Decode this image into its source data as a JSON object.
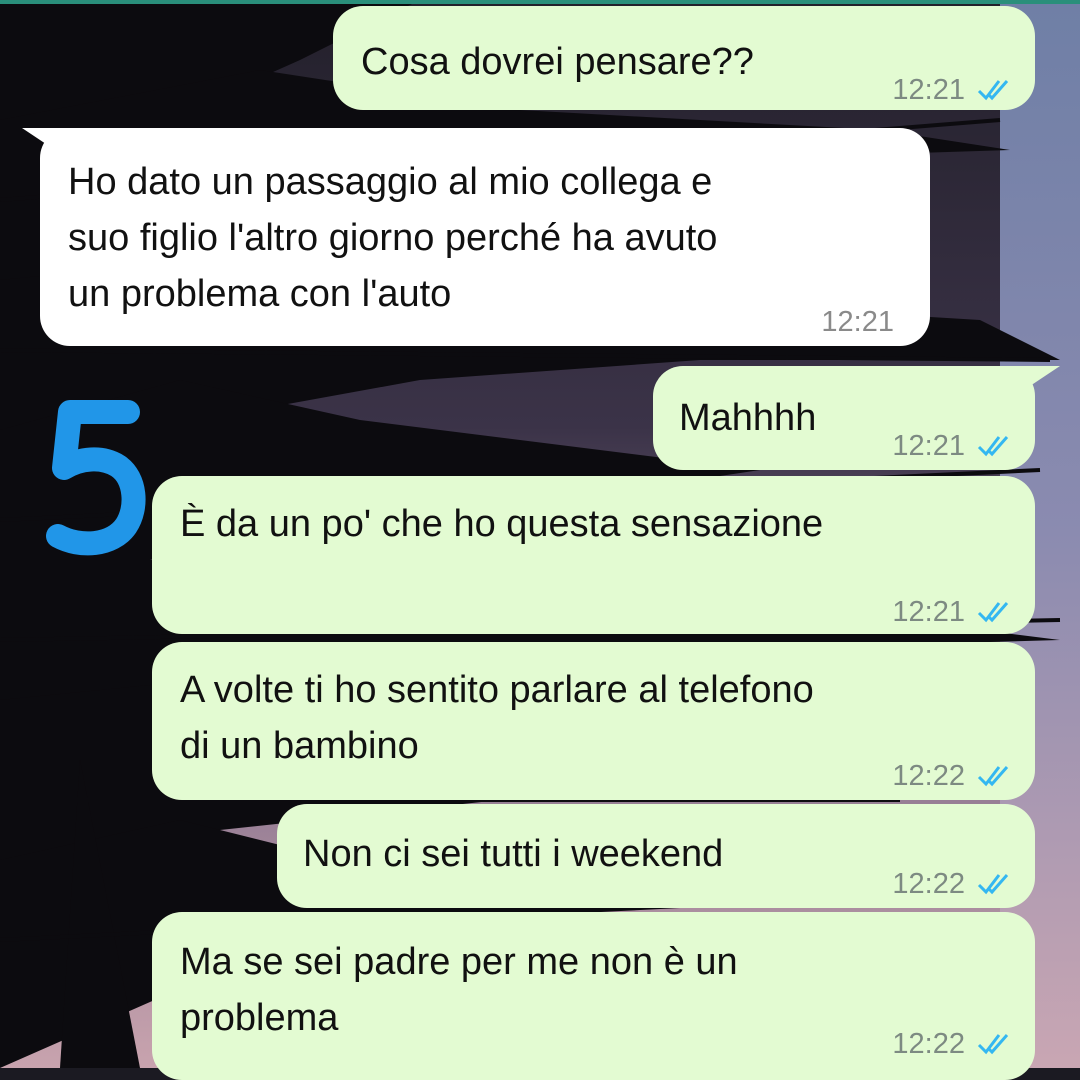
{
  "colors": {
    "outgoing_bubble": "#e3fbd2",
    "incoming_bubble": "#ffffff",
    "read_ticks": "#34b7f1",
    "annotation_number": "#2196e8"
  },
  "annotation": {
    "number": "5"
  },
  "messages": [
    {
      "direction": "outgoing",
      "text": "Cosa dovrei pensare??",
      "time": "12:21",
      "status": "read"
    },
    {
      "direction": "incoming",
      "text": "Ho dato un passaggio al mio collega e\nsuo figlio l'altro giorno perché ha avuto\nun problema con l'auto",
      "time": "12:21"
    },
    {
      "direction": "outgoing",
      "text": "Mahhhh",
      "time": "12:21",
      "status": "read"
    },
    {
      "direction": "outgoing",
      "text": "È da un po' che ho questa sensazione",
      "time": "12:21",
      "status": "read"
    },
    {
      "direction": "outgoing",
      "text": "A volte ti ho sentito parlare al telefono\ndi un bambino",
      "time": "12:22",
      "status": "read"
    },
    {
      "direction": "outgoing",
      "text": "Non ci sei tutti i weekend",
      "time": "12:22",
      "status": "read"
    },
    {
      "direction": "outgoing",
      "text": "Ma se sei padre per me non è un\nproblema",
      "time": "12:22",
      "status": "read"
    }
  ]
}
